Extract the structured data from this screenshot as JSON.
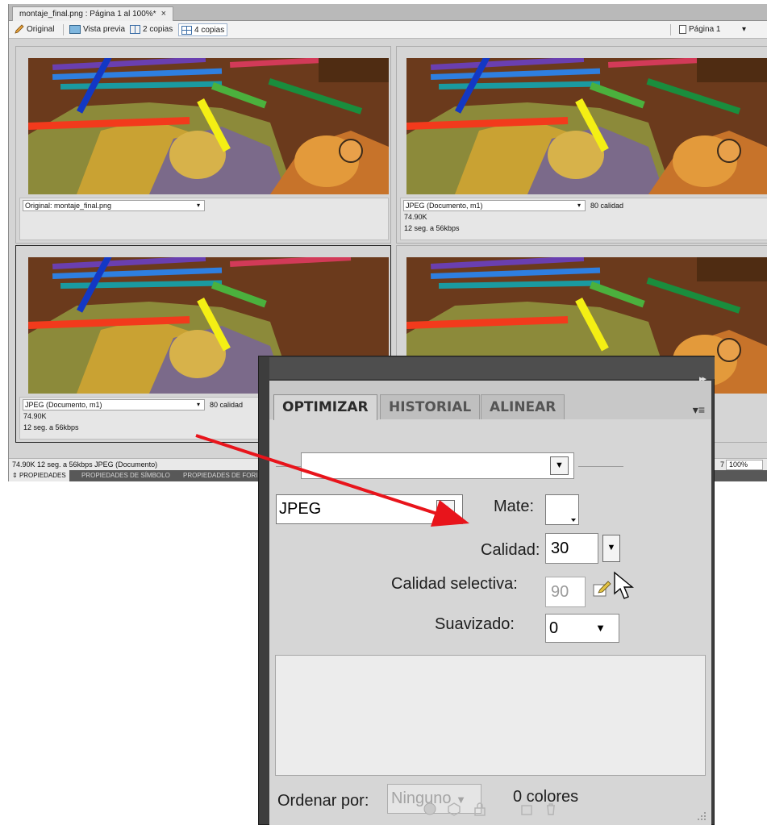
{
  "document": {
    "tab_title": "montaje_final.png : Página 1 al 100%*",
    "tab_close": "×"
  },
  "view_toolbar": {
    "original": "Original",
    "preview": "Vista previa",
    "two_up": "2 copias",
    "four_up": "4 copias",
    "page": "Página 1",
    "page_arrow": "▾"
  },
  "panes": [
    {
      "format": "Original: montaje_final.png",
      "quality": "",
      "size": "",
      "time": ""
    },
    {
      "format": "JPEG (Documento, m1)",
      "quality": "80 calidad",
      "size": "74.90K",
      "time": "12 seg. a 56kbps"
    },
    {
      "format": "JPEG (Documento, m1)",
      "quality": "80 calidad",
      "size": "74.90K",
      "time": "12 seg. a 56kbps"
    }
  ],
  "status_bar": {
    "info": "74.90K  12 seg. a 56kbps  JPEG (Documento)",
    "page_fragment": "7",
    "zoom": "100%"
  },
  "property_tabs": [
    "PROPIEDADES",
    "PROPIEDADES DE SÍMBOLO",
    "PROPIEDADES DE FORI"
  ],
  "optimize_panel": {
    "tabs": [
      "OPTIMIZAR",
      "HISTORIAL",
      "ALINEAR"
    ],
    "preset": "",
    "format": "JPEG",
    "matte_label": "Mate:",
    "quality_label": "Calidad:",
    "quality_value": "30",
    "selective_quality_label": "Calidad selectiva:",
    "selective_quality_value": "90",
    "smoothing_label": "Suavizado:",
    "smoothing_value": "0",
    "sort_label": "Ordenar por:",
    "sort_value": "Ninguno",
    "color_count": "0 colores"
  },
  "colors": {
    "annotation_arrow": "#e8141b",
    "panel_frame": "#3d3d3d",
    "panel_body": "#d6d6d6"
  },
  "icons": [
    "pencil-icon",
    "preview-icon",
    "two-up-icon",
    "four-up-icon",
    "page-icon",
    "dropdown-arrow-icon",
    "panel-menu-icon",
    "edit-selective-icon",
    "mouse-cursor-icon"
  ]
}
